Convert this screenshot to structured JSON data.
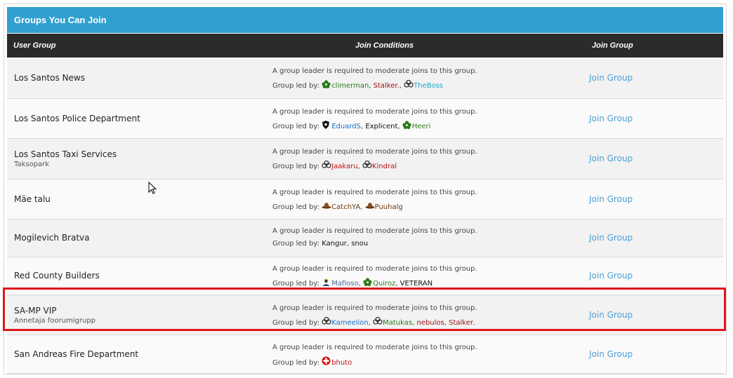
{
  "panel": {
    "title": "Groups You Can Join",
    "columns": {
      "group": "User Group",
      "conditions": "Join Conditions",
      "join": "Join Group"
    }
  },
  "groups": [
    {
      "name": "Los Santos News",
      "desc": "",
      "condition": "A group leader is required to moderate joins to this group.",
      "led_label": "Group led by:",
      "leaders": [
        {
          "name": "climerman",
          "icon": "flower-icon",
          "color": "#2a7a1a"
        },
        {
          "name": "Stalker.",
          "icon": "",
          "color": "#9a1010"
        },
        {
          "name": "TheBoss",
          "icon": "triskele-icon",
          "color": "#1aa8c8"
        }
      ],
      "join": "Join Group"
    },
    {
      "name": "Los Santos Police Department",
      "desc": "",
      "condition": "A group leader is required to moderate joins to this group.",
      "led_label": "Group led by:",
      "leaders": [
        {
          "name": "EduardS",
          "icon": "badge-icon",
          "color": "#1a70c8"
        },
        {
          "name": "Explicent",
          "icon": "",
          "color": "#111111"
        },
        {
          "name": "Heeri",
          "icon": "flower-icon",
          "color": "#2a7a1a"
        }
      ],
      "join": "Join Group"
    },
    {
      "name": "Los Santos Taxi Services",
      "desc": "Taksopark",
      "condition": "A group leader is required to moderate joins to this group.",
      "led_label": "Group led by:",
      "leaders": [
        {
          "name": "Jaakaru",
          "icon": "triskele-icon",
          "color": "#c01010"
        },
        {
          "name": "Kindral",
          "icon": "triskele-icon",
          "color": "#c01010"
        }
      ],
      "join": "Join Group"
    },
    {
      "name": "Mäe talu",
      "desc": "",
      "condition": "A group leader is required to moderate joins to this group.",
      "led_label": "Group led by:",
      "leaders": [
        {
          "name": "CatchYA",
          "icon": "cowboy-hat-icon",
          "color": "#6a3a10"
        },
        {
          "name": "Puuhalg",
          "icon": "cowboy-hat-icon",
          "color": "#6a3a10"
        }
      ],
      "join": "Join Group"
    },
    {
      "name": "Mogilevich Bratva",
      "desc": "",
      "condition": "A group leader is required to moderate joins to this group.",
      "led_label": "Group led by:",
      "leaders": [
        {
          "name": "Kangur",
          "icon": "",
          "color": "#111111"
        },
        {
          "name": "snou",
          "icon": "",
          "color": "#111111"
        }
      ],
      "join": "Join Group"
    },
    {
      "name": "Red County Builders",
      "desc": "",
      "condition": "A group leader is required to moderate joins to this group.",
      "led_label": "Group led by:",
      "leaders": [
        {
          "name": "Mafioso",
          "icon": "worker-icon",
          "color": "#4a6a90"
        },
        {
          "name": "Quiroz",
          "icon": "flower-icon",
          "color": "#2a7a1a"
        },
        {
          "name": "VETERAN",
          "icon": "",
          "color": "#111111"
        }
      ],
      "join": "Join Group"
    },
    {
      "name": "SA-MP VIP",
      "desc": "Annetaja foorumigrupp",
      "condition": "A group leader is required to moderate joins to this group.",
      "led_label": "Group led by:",
      "leaders": [
        {
          "name": "Kameelion",
          "icon": "triskele-icon",
          "color": "#1a70c8"
        },
        {
          "name": "Matukas",
          "icon": "triskele-icon",
          "color": "#2a7a1a"
        },
        {
          "name": "nebulos",
          "icon": "",
          "color": "#9a1010"
        },
        {
          "name": "Stalker.",
          "icon": "",
          "color": "#9a1010"
        }
      ],
      "join": "Join Group"
    },
    {
      "name": "San Andreas Fire Department",
      "desc": "",
      "condition": "A group leader is required to moderate joins to this group.",
      "led_label": "Group led by:",
      "leaders": [
        {
          "name": "bhuto",
          "icon": "red-cross-icon",
          "color": "#c01010"
        }
      ],
      "join": "Join Group"
    }
  ]
}
